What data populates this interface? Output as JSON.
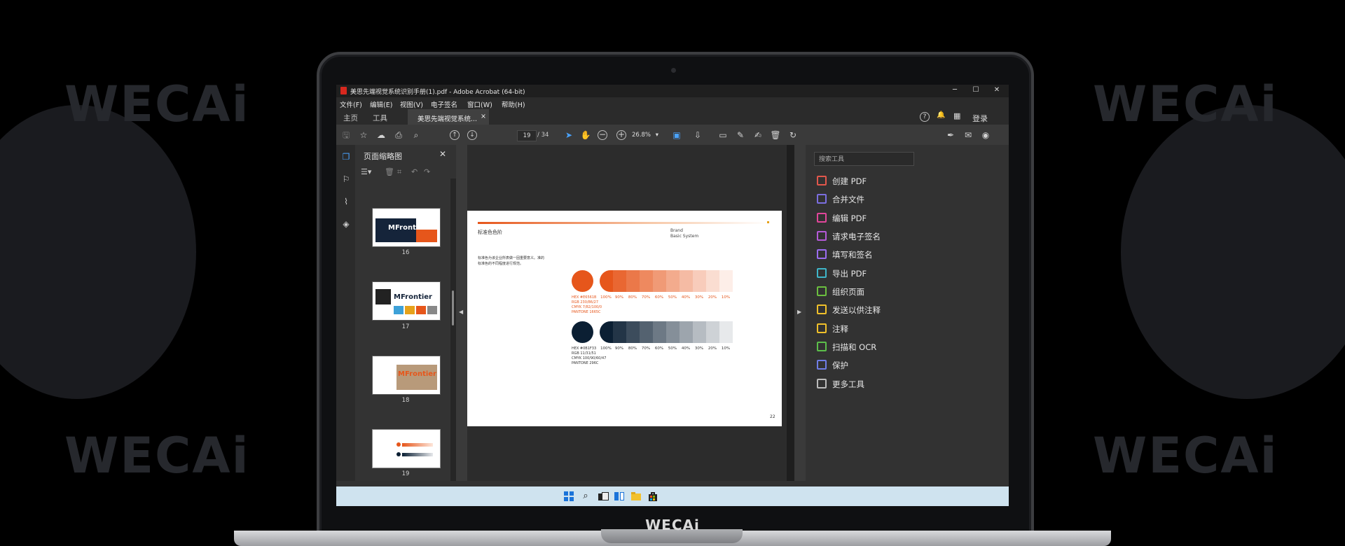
{
  "background": {
    "watermark": "WECAi",
    "laptop_logo": "WECAi"
  },
  "window": {
    "title": "美思先端视觉系统识别手册(1).pdf - Adobe Acrobat (64-bit)",
    "minimize": "─",
    "maximize": "☐",
    "close": "✕"
  },
  "menubar": [
    "文件(F)",
    "编辑(E)",
    "视图(V)",
    "电子签名",
    "窗口(W)",
    "帮助(H)"
  ],
  "tabs": {
    "home": "主页",
    "tools": "工具",
    "document": "美思先端视觉系统...",
    "document_close": "×",
    "help_icon": "?",
    "bell_icon": "🔔",
    "apps_icon": "▦",
    "login": "登录"
  },
  "toolbar": {
    "page_current": "19",
    "page_total": "/ 34",
    "zoom": "26.8%",
    "zoom_arrow": "▾"
  },
  "thumbnails": {
    "panel_title": "页面缩略图",
    "close": "✕",
    "pages": [
      {
        "label": "16",
        "logo": "MFrontier"
      },
      {
        "label": "17",
        "logo": "MFrontier"
      },
      {
        "label": "18",
        "logo": "MFrontier"
      },
      {
        "label": "19",
        "logo": ""
      }
    ]
  },
  "page": {
    "section_title": "标准色色阶",
    "brand_line1": "Brand",
    "brand_line2": "Basic System",
    "desc_line1": "标准色为该企业所表做一固重要意义。准的",
    "desc_line2": "标准色的不同程度进行规范。",
    "page_number": "22",
    "orange": {
      "color": "#E6561B",
      "specs": [
        "HEX #E6561B",
        "RGB 230/86/27",
        "CMYK 7/82/100/0",
        "PANTONE 1665C"
      ]
    },
    "navy": {
      "color": "#0B1F33",
      "specs": [
        "HEX #0B1F33",
        "RGB 11/31/51",
        "CMYK 100/90/60/47",
        "PANTONE 296C"
      ]
    },
    "percentages": [
      "100%",
      "90%",
      "80%",
      "70%",
      "60%",
      "50%",
      "40%",
      "30%",
      "20%",
      "10%"
    ]
  },
  "tools_panel": {
    "search_placeholder": "搜索工具",
    "items": [
      {
        "label": "创建 PDF",
        "color": "#e2574c"
      },
      {
        "label": "合并文件",
        "color": "#7b6ee0"
      },
      {
        "label": "编辑 PDF",
        "color": "#e1469a"
      },
      {
        "label": "请求电子签名",
        "color": "#b45ad8"
      },
      {
        "label": "填写和签名",
        "color": "#9b6cf0"
      },
      {
        "label": "导出 PDF",
        "color": "#3fb6c9"
      },
      {
        "label": "组织页面",
        "color": "#6bbf3f"
      },
      {
        "label": "发送以供注释",
        "color": "#f0c02a"
      },
      {
        "label": "注释",
        "color": "#f0c02a"
      },
      {
        "label": "扫描和 OCR",
        "color": "#5cbf4a"
      },
      {
        "label": "保护",
        "color": "#6f7de6"
      },
      {
        "label": "更多工具",
        "color": "#bbbbbb"
      }
    ]
  }
}
